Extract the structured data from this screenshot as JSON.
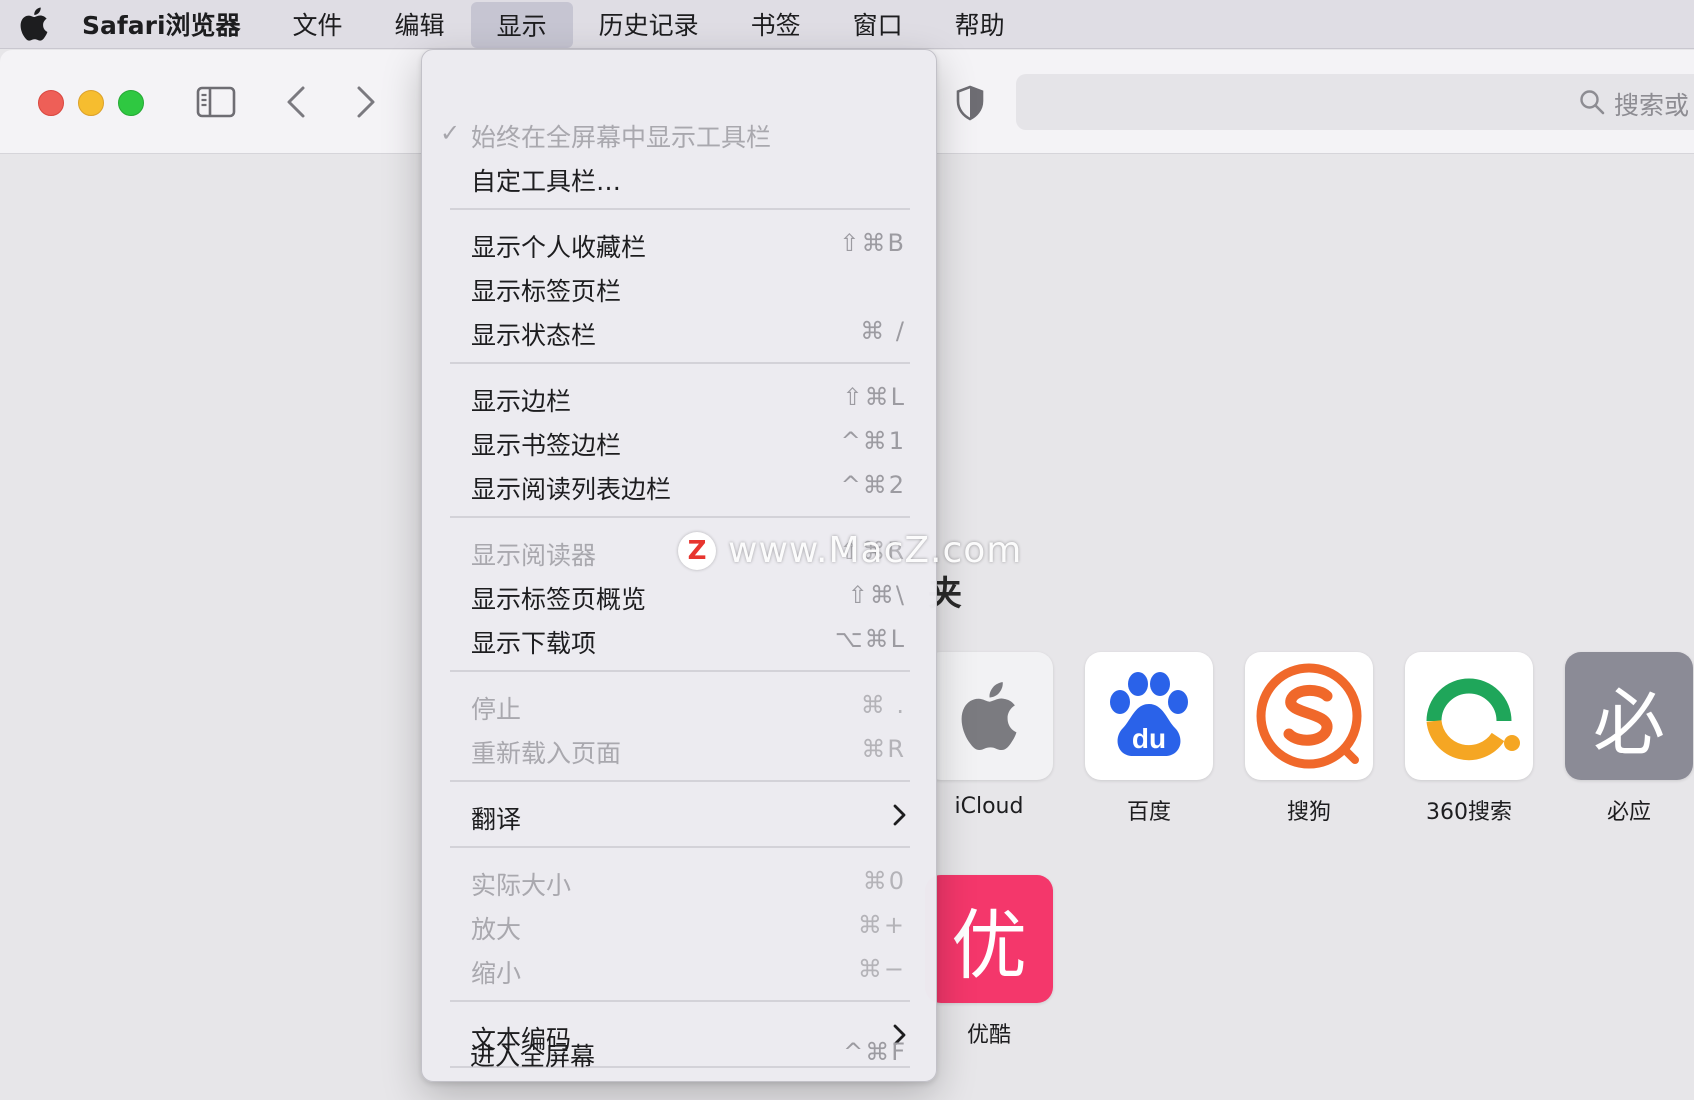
{
  "menubar": {
    "app_name": "Safari浏览器",
    "items": [
      "文件",
      "编辑",
      "显示",
      "历史记录",
      "书签",
      "窗口",
      "帮助"
    ],
    "active_item": "显示"
  },
  "toolbar": {
    "search_placeholder": "搜索或"
  },
  "view_menu": {
    "items": [
      {
        "label": "始终在全屏幕中显示工具栏",
        "shortcut": "",
        "checked": true,
        "disabled": true
      },
      {
        "label": "自定工具栏…",
        "shortcut": "",
        "disabled": false
      },
      {
        "label": "显示个人收藏栏",
        "shortcut": "⇧⌘B",
        "disabled": false
      },
      {
        "label": "显示标签页栏",
        "shortcut": "",
        "disabled": false
      },
      {
        "label": "显示状态栏",
        "shortcut": "⌘ /",
        "disabled": false
      },
      {
        "label": "显示边栏",
        "shortcut": "⇧⌘L",
        "disabled": false
      },
      {
        "label": "显示书签边栏",
        "shortcut": "^⌘1",
        "disabled": false
      },
      {
        "label": "显示阅读列表边栏",
        "shortcut": "^⌘2",
        "disabled": false
      },
      {
        "label": "显示阅读器",
        "shortcut": "⇧⌘R",
        "disabled": true
      },
      {
        "label": "显示标签页概览",
        "shortcut": "⇧⌘\\",
        "disabled": false
      },
      {
        "label": "显示下载项",
        "shortcut": "⌥⌘L",
        "disabled": false
      },
      {
        "label": "停止",
        "shortcut": "⌘ .",
        "disabled": true
      },
      {
        "label": "重新载入页面",
        "shortcut": "⌘R",
        "disabled": true
      },
      {
        "label": "翻译",
        "submenu": true,
        "disabled": false
      },
      {
        "label": "实际大小",
        "shortcut": "⌘0",
        "disabled": true
      },
      {
        "label": "放大",
        "shortcut": "⌘+",
        "disabled": true
      },
      {
        "label": "缩小",
        "shortcut": "⌘−",
        "disabled": true
      },
      {
        "label": "文本编码",
        "submenu": true,
        "disabled": false
      },
      {
        "label": "进入全屏幕",
        "shortcut": "^⌘F",
        "disabled": false
      }
    ]
  },
  "favorites": {
    "partial_heading_char": "夹",
    "tiles": [
      {
        "label": "iCloud",
        "icon": "apple-logo-icon"
      },
      {
        "label": "百度",
        "icon": "baidu-paw-icon",
        "icon_text": "du"
      },
      {
        "label": "搜狗",
        "icon": "sogou-s-icon"
      },
      {
        "label": "360搜索",
        "icon": "360-ring-icon"
      },
      {
        "label": "必应",
        "icon": "bing-character-icon",
        "icon_text": "必"
      },
      {
        "label": "优酷",
        "icon": "youku-character-icon",
        "icon_text": "优"
      }
    ]
  },
  "watermark": {
    "logo_text": "Z",
    "text": "www.MacZ.com"
  },
  "colors": {
    "close": "#ee5f57",
    "minimize": "#f6bd2f",
    "maximize": "#2fc841",
    "baidu": "#2a62e9",
    "sogou": "#f0682a",
    "green360": "#1fa65a",
    "orange360": "#f5a623",
    "bing_bg": "#8b8b96",
    "youku": "#f4376b"
  }
}
